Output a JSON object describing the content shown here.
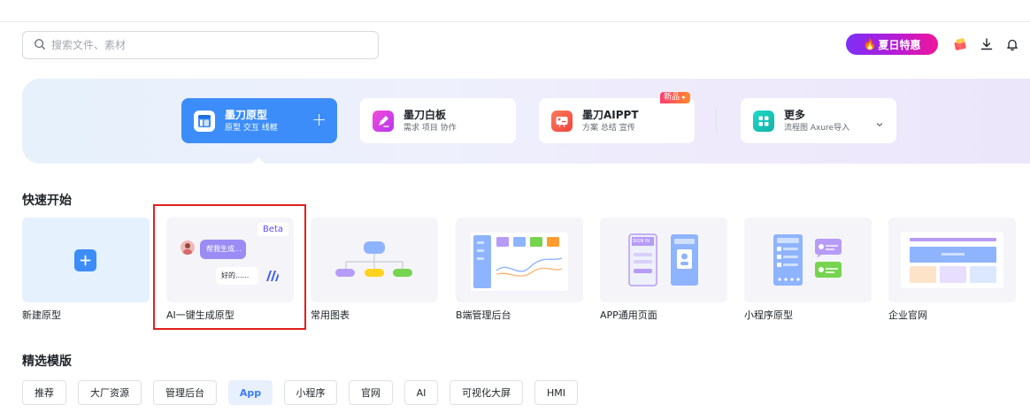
{
  "search": {
    "placeholder": "搜索文件、素材"
  },
  "header": {
    "promo_label": "夏日特惠"
  },
  "create_cards": [
    {
      "title": "墨刀原型",
      "subtitle": "原型 交互 线框"
    },
    {
      "title": "墨刀白板",
      "subtitle": "需求 项目 协作"
    },
    {
      "title": "墨刀AIPPT",
      "subtitle": "方案 总结 宣传",
      "badge": "新品"
    },
    {
      "title": "更多",
      "subtitle": "流程图 Axure导入"
    }
  ],
  "quick_start": {
    "title": "快速开始",
    "items": [
      {
        "label": "新建原型"
      },
      {
        "label": "AI一键生成原型",
        "badge": "Beta",
        "bubble1": "帮我生成...",
        "bubble2": "好的......"
      },
      {
        "label": "常用图表"
      },
      {
        "label": "B端管理后台"
      },
      {
        "label": "APP通用页面",
        "screen_text": "SIGN IN"
      },
      {
        "label": "小程序原型"
      },
      {
        "label": "企业官网"
      }
    ]
  },
  "templates": {
    "title": "精选模版",
    "tags": [
      "推荐",
      "大厂资源",
      "管理后台",
      "App",
      "小程序",
      "官网",
      "AI",
      "可视化大屏",
      "HMI"
    ],
    "active_tag": "App"
  },
  "colors": {
    "accent": "#3c8dfa",
    "active_tag_bg": "#e8f0fe",
    "highlight_border": "#e02020"
  }
}
